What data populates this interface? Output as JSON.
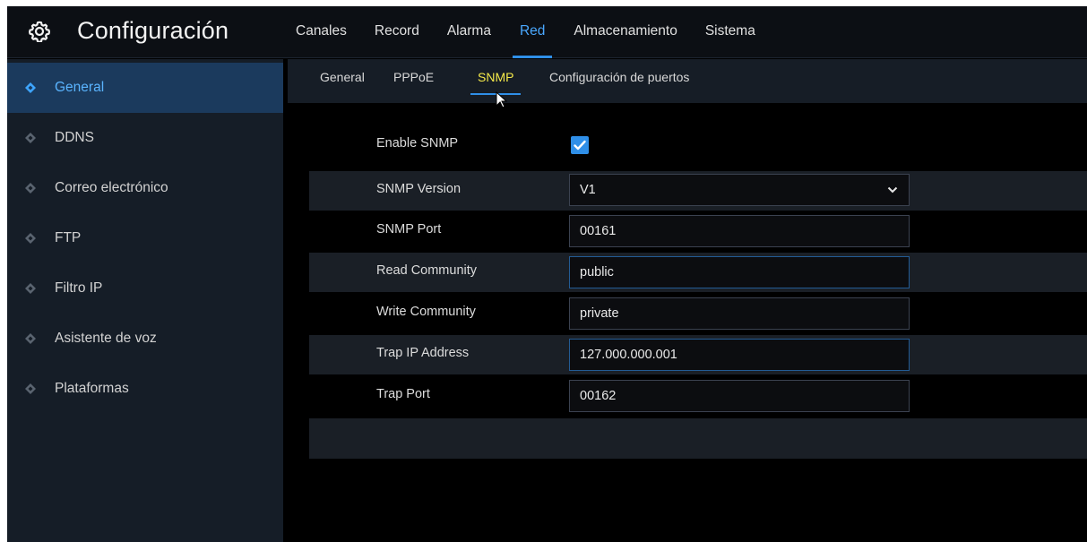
{
  "app": {
    "title": "Configuración",
    "title_icon": "gear-icon"
  },
  "top_tabs": [
    {
      "label": "Canales",
      "active": false
    },
    {
      "label": "Record",
      "active": false
    },
    {
      "label": "Alarma",
      "active": false
    },
    {
      "label": "Red",
      "active": true
    },
    {
      "label": "Almacenamiento",
      "active": false
    },
    {
      "label": "Sistema",
      "active": false
    }
  ],
  "sidebar": {
    "items": [
      {
        "label": "General",
        "active": true,
        "icon": "diamond-icon"
      },
      {
        "label": "DDNS",
        "active": false,
        "icon": "diamond-icon"
      },
      {
        "label": "Correo electrónico",
        "active": false,
        "icon": "diamond-icon"
      },
      {
        "label": "FTP",
        "active": false,
        "icon": "diamond-icon"
      },
      {
        "label": "Filtro IP",
        "active": false,
        "icon": "diamond-icon"
      },
      {
        "label": "Asistente de voz",
        "active": false,
        "icon": "diamond-icon"
      },
      {
        "label": "Plataformas",
        "active": false,
        "icon": "diamond-icon"
      }
    ]
  },
  "sub_tabs": [
    {
      "label": "General",
      "active": false
    },
    {
      "label": "PPPoE",
      "active": false
    },
    {
      "label": "SNMP",
      "active": true
    },
    {
      "label": "Configuración de puertos",
      "active": false
    }
  ],
  "form": {
    "enable_snmp": {
      "label": "Enable SNMP",
      "checked": true
    },
    "snmp_version": {
      "label": "SNMP Version",
      "value": "V1"
    },
    "snmp_port": {
      "label": "SNMP Port",
      "value": "00161"
    },
    "read_community": {
      "label": "Read Community",
      "value": "public"
    },
    "write_community": {
      "label": "Write Community",
      "value": "private"
    },
    "trap_ip": {
      "label": "Trap IP Address",
      "value": "127.000.000.001"
    },
    "trap_port": {
      "label": "Trap Port",
      "value": "00162"
    }
  },
  "colors": {
    "accent": "#2f8fe8",
    "active_top_tab": "#4aa8ff",
    "active_subtab": "#f4e94a",
    "sidebar_active_bg": "#1b3a5d",
    "sidebar_active_text": "#5ab4ff",
    "sidebar_bg": "#151d27"
  }
}
